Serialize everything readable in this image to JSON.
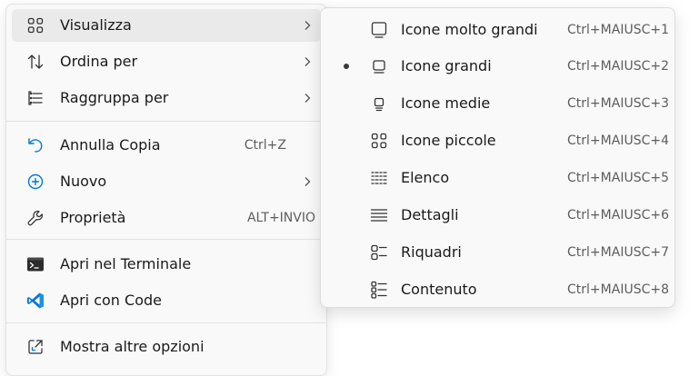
{
  "menu": {
    "items": [
      {
        "label": "Visualizza",
        "icon": "grid-four-icon",
        "submenu": true
      },
      {
        "label": "Ordina per",
        "icon": "sort-arrows-icon",
        "submenu": true
      },
      {
        "label": "Raggruppa per",
        "icon": "group-list-icon",
        "submenu": true
      },
      {
        "label": "Annulla Copia",
        "icon": "undo-icon",
        "shortcut": "Ctrl+Z"
      },
      {
        "label": "Nuovo",
        "icon": "new-plus-circle-icon",
        "submenu": true
      },
      {
        "label": "Proprietà",
        "icon": "wrench-icon",
        "shortcut": "ALT+INVIO"
      },
      {
        "label": "Apri nel Terminale",
        "icon": "terminal-icon"
      },
      {
        "label": "Apri con Code",
        "icon": "vscode-icon"
      },
      {
        "label": "Mostra altre opzioni",
        "icon": "share-external-icon"
      }
    ]
  },
  "submenu": {
    "items": [
      {
        "label": "Icone molto grandi",
        "shortcut": "Ctrl+MAIUSC+1",
        "icon": "monitor-extra-large-icon",
        "selected": false
      },
      {
        "label": "Icone grandi",
        "shortcut": "Ctrl+MAIUSC+2",
        "icon": "monitor-large-icon",
        "selected": true
      },
      {
        "label": "Icone medie",
        "shortcut": "Ctrl+MAIUSC+3",
        "icon": "monitor-medium-icon",
        "selected": false
      },
      {
        "label": "Icone piccole",
        "shortcut": "Ctrl+MAIUSC+4",
        "icon": "small-icons-grid-icon",
        "selected": false
      },
      {
        "label": "Elenco",
        "shortcut": "Ctrl+MAIUSC+5",
        "icon": "list-columns-icon",
        "selected": false
      },
      {
        "label": "Dettagli",
        "shortcut": "Ctrl+MAIUSC+6",
        "icon": "details-lines-icon",
        "selected": false
      },
      {
        "label": "Riquadri",
        "shortcut": "Ctrl+MAIUSC+7",
        "icon": "tiles-icon",
        "selected": false
      },
      {
        "label": "Contenuto",
        "shortcut": "Ctrl+MAIUSC+8",
        "icon": "content-list-icon",
        "selected": false
      }
    ]
  },
  "colors": {
    "accent_blue": "#0078d4",
    "vscode_blue": "#007acc",
    "text": "#1a1a1a",
    "shortcut_text": "#5d5d5d",
    "menu_bg": "#f9f9f9",
    "hover_bg": "#eaeaea"
  }
}
